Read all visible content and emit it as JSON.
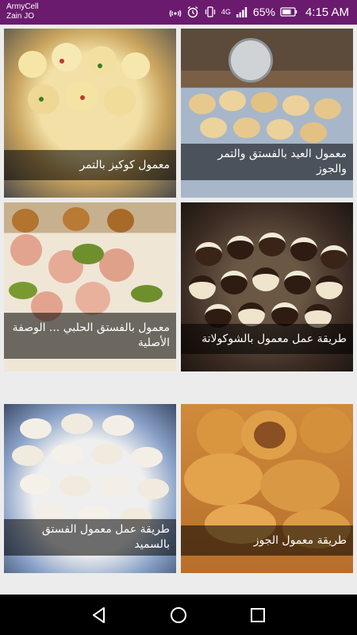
{
  "status_bar": {
    "carrier_1": "ArmyCell",
    "carrier_2": "Zain JO",
    "network_type": "4G",
    "battery_percent": "65%",
    "time": "4:15 AM",
    "icons": [
      "hotspot-icon",
      "alarm-icon",
      "vibrate-icon",
      "signal-icon",
      "battery-icon"
    ]
  },
  "recipes": [
    {
      "title": "معمول كوكيز بالتمر"
    },
    {
      "title": "معمول العيد بالفستق والتمر والجوز"
    },
    {
      "title": "معمول بالفستق الحلبي ... الوصفة الأصلية"
    },
    {
      "title": "طريقة عمل معمول بالشوكولاتة"
    },
    {
      "title": "طريقة عمل معمول الفستق بالسميد"
    },
    {
      "title": "طريقة معمول الجوز"
    }
  ],
  "nav_bar": {
    "icons": [
      "back-icon",
      "home-icon",
      "recents-icon"
    ]
  },
  "colors": {
    "status_bar": "#6a1b6e",
    "background": "#ececec",
    "nav_bar": "#000000"
  }
}
